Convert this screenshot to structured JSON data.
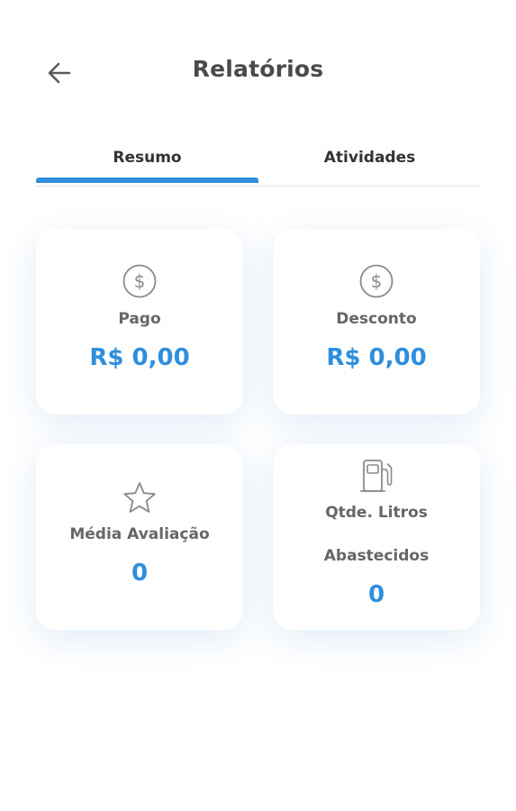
{
  "header": {
    "title": "Relatórios",
    "back_icon": "arrow-left-icon"
  },
  "tabs": [
    {
      "label": "Resumo",
      "active": true
    },
    {
      "label": "Atividades",
      "active": false
    }
  ],
  "colors": {
    "accent": "#2f8fdd",
    "label": "#666666",
    "title": "#4a4a4a"
  },
  "cards": {
    "pago": {
      "icon": "dollar-circle-icon",
      "label": "Pago",
      "value": "R$ 0,00"
    },
    "desconto": {
      "icon": "dollar-circle-icon",
      "label": "Desconto",
      "value": "R$ 0,00"
    },
    "media": {
      "icon": "star-icon",
      "label": "Média Avaliação",
      "value": "0"
    },
    "litros": {
      "icon": "fuel-pump-icon",
      "label_line1": "Qtde. Litros",
      "label_line2": "Abastecidos",
      "value": "0"
    }
  }
}
